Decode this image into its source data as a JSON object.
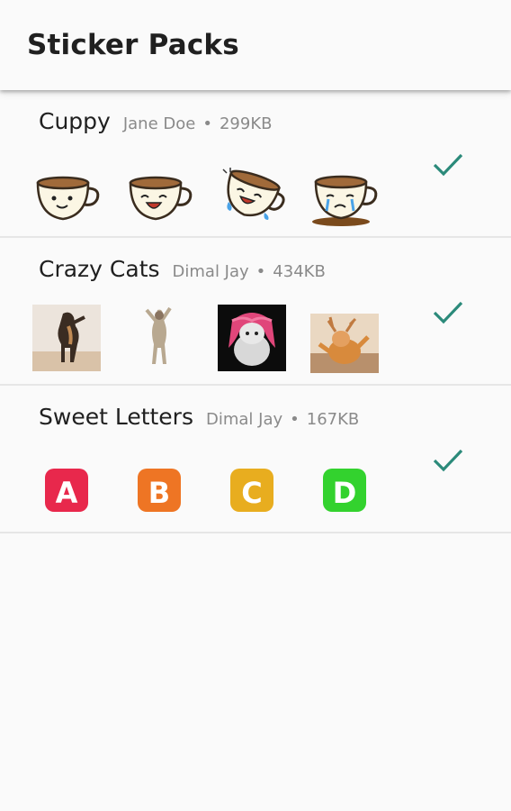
{
  "appbar": {
    "title": "Sticker Packs"
  },
  "packs": [
    {
      "name": "Cuppy",
      "publisher": "Jane Doe",
      "separator": "•",
      "size": "299KB",
      "selected": true,
      "stickers": [
        "cup-smile-sticker",
        "cup-laugh-sticker",
        "cup-cry-laughing-sticker",
        "cup-crying-sticker"
      ]
    },
    {
      "name": "Crazy Cats",
      "publisher": "Dimal Jay",
      "separator": "•",
      "size": "434KB",
      "selected": true,
      "stickers": [
        "cat-standing-sticker",
        "cat-dancing-sticker",
        "cat-pink-wig-sticker",
        "cat-antlers-sticker"
      ]
    },
    {
      "name": "Sweet Letters",
      "publisher": "Dimal Jay",
      "separator": "•",
      "size": "167KB",
      "selected": true,
      "stickers": [
        "letter-a-sticker",
        "letter-b-sticker",
        "letter-c-sticker",
        "letter-d-sticker"
      ],
      "letters": [
        "A",
        "B",
        "C",
        "D"
      ],
      "letter_colors": [
        "#e8284c",
        "#ee7524",
        "#e8ad1f",
        "#33d22e"
      ]
    }
  ],
  "colors": {
    "check": "#2b8a7a",
    "divider": "#e6e6e6"
  }
}
